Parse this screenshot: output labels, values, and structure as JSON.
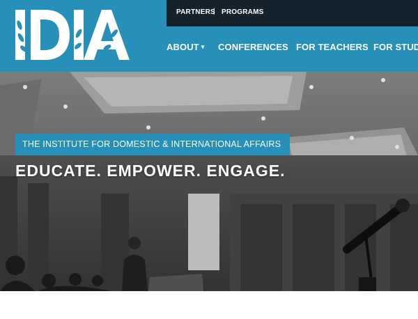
{
  "header": {
    "logo_text": "IDIA",
    "brand_color": "#2690b8",
    "util_bar_color": "#13222c",
    "util_links": [
      "PARTNERS",
      "PROGRAMS"
    ],
    "util_separator": "|",
    "nav": [
      {
        "label": "ABOUT",
        "has_dropdown": true,
        "caret": "▾"
      },
      {
        "label": "CONFERENCES"
      },
      {
        "label": "FOR TEACHERS"
      },
      {
        "label": "FOR STUDE"
      }
    ]
  },
  "hero": {
    "badge": "THE INSTITUTE FOR DOMESTIC & INTERNATIONAL AFFAIRS",
    "tagline": "EDUCATE. EMPOWER. ENGAGE.",
    "image_description_icon": "conference-hall-photo"
  }
}
